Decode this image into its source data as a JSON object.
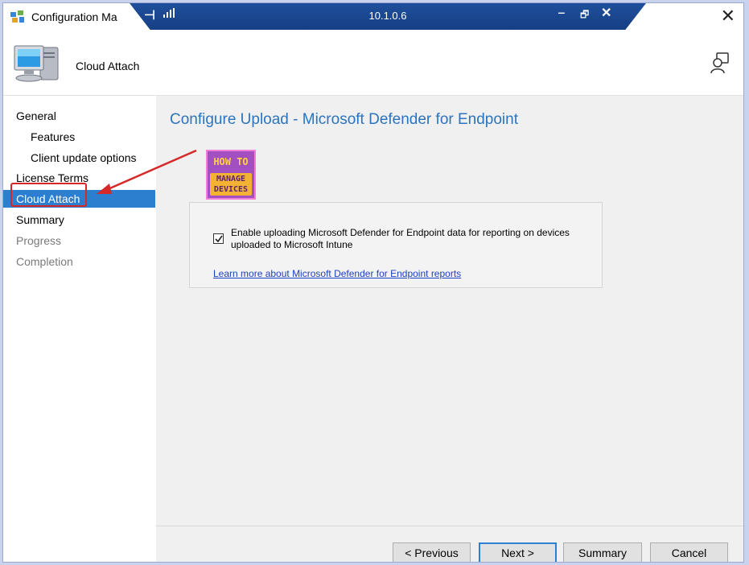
{
  "window": {
    "title": "Configuration Ma",
    "close_glyph": "✕"
  },
  "remote_toolbar": {
    "host": "10.1.0.6",
    "pin_glyph": "⊣",
    "minimize_glyph": "‒",
    "restore_glyph": "🗗",
    "close_glyph": "✕",
    "color": "#1f4f9c"
  },
  "header": {
    "title": "Cloud Attach"
  },
  "sidebar": {
    "items": [
      {
        "label": "General"
      },
      {
        "label": "Features"
      },
      {
        "label": "Client update options"
      },
      {
        "label": "License Terms"
      },
      {
        "label": "Cloud Attach"
      },
      {
        "label": "Summary"
      },
      {
        "label": "Progress"
      },
      {
        "label": "Completion"
      }
    ],
    "selected": "Cloud Attach",
    "selected_color": "#2c7fcf"
  },
  "main": {
    "heading": "Configure Upload - Microsoft Defender for Endpoint",
    "heading_color": "#2b74bf",
    "logo": {
      "line1": "HOW TO",
      "line2a": "MANAGE",
      "line2b": "DEVICES"
    },
    "checkbox": {
      "checked": true,
      "label": "Enable uploading Microsoft Defender for Endpoint data for reporting on devices uploaded to Microsoft Intune"
    },
    "link": "Learn more about Microsoft Defender for Endpoint reports"
  },
  "buttons": {
    "previous": "< Previous",
    "next": "Next >",
    "summary": "Summary",
    "cancel": "Cancel"
  },
  "annotation": {
    "color": "#d62828"
  }
}
